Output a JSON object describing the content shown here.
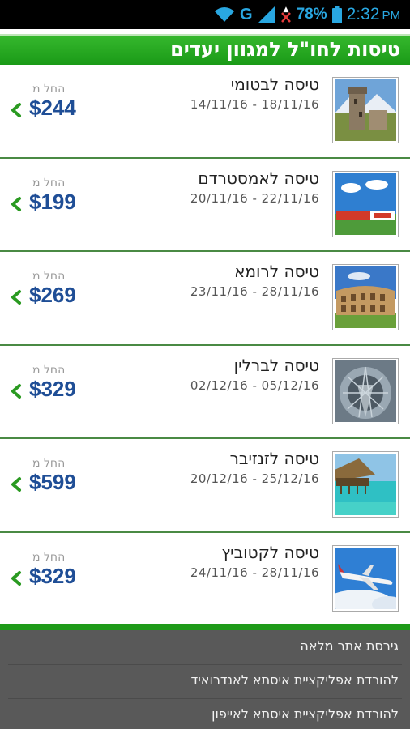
{
  "status_bar": {
    "network": "G",
    "battery": "78%",
    "time": "2:32",
    "ampm": "PM",
    "icons": [
      "wifi-icon",
      "signal-icon",
      "no-sim-icon",
      "battery-icon"
    ]
  },
  "header": {
    "title": "טיסות לחו\"ל למגוון יעדים"
  },
  "colors": {
    "header_green": "#1a9a17",
    "price_blue": "#1f4e96",
    "chevron_green": "#2a9a21",
    "footer_gray": "#595959"
  },
  "flights": [
    {
      "destination": "טיסה לבטומי",
      "dates": "14/11/16 - 18/11/16",
      "from_label": "החל מ",
      "price": "$244",
      "image": "batumi-tower-image"
    },
    {
      "destination": "טיסה לאמסטרדם",
      "dates": "20/11/16 - 22/11/16",
      "from_label": "החל מ",
      "price": "$199",
      "image": "amsterdam-sign-image"
    },
    {
      "destination": "טיסה לרומא",
      "dates": "23/11/16 - 28/11/16",
      "from_label": "החל מ",
      "price": "$269",
      "image": "colosseum-image"
    },
    {
      "destination": "טיסה לברלין",
      "dates": "02/12/16 - 05/12/16",
      "from_label": "החל מ",
      "price": "$329",
      "image": "reichstag-dome-image"
    },
    {
      "destination": "טיסה לזנזיבר",
      "dates": "20/12/16 - 25/12/16",
      "from_label": "החל מ",
      "price": "$599",
      "image": "zanzibar-beach-image"
    },
    {
      "destination": "טיסה לקטוביץ",
      "dates": "24/11/16 - 28/11/16",
      "from_label": "החל מ",
      "price": "$329",
      "image": "airplane-image"
    }
  ],
  "footer": {
    "links": [
      "גירסת אתר מלאה",
      "להורדת אפליקציית איסתא לאנדרואיד",
      "להורדת אפליקציית איסתא לאייפון"
    ]
  }
}
